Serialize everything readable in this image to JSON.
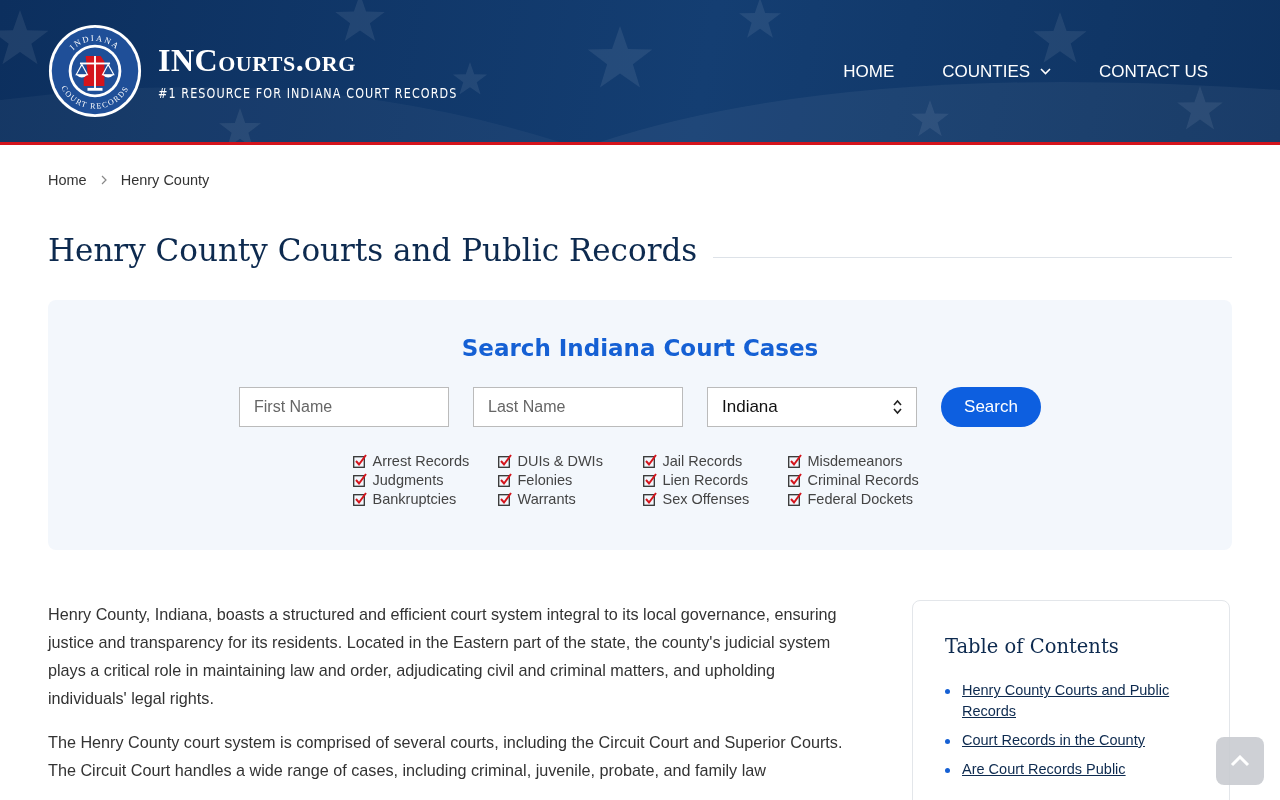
{
  "header": {
    "seal_top": "INDIANA",
    "seal_bottom": "COURT RECORDS",
    "site_name": "INCourts.org",
    "tagline": "#1 RESOURCE FOR INDIANA COURT RECORDS",
    "nav": [
      {
        "label": "HOME",
        "dropdown": false
      },
      {
        "label": "COUNTIES",
        "dropdown": true
      },
      {
        "label": "CONTACT US",
        "dropdown": false
      }
    ]
  },
  "breadcrumb": [
    "Home",
    "Henry County"
  ],
  "title": "Henry County Courts and Public Records",
  "search": {
    "heading": "Search Indiana Court Cases",
    "first_name": {
      "placeholder": "First Name"
    },
    "last_name": {
      "placeholder": "Last Name"
    },
    "state": "Indiana",
    "button": "Search",
    "record_types": [
      {
        "label": "Arrest Records",
        "checked": true
      },
      {
        "label": "DUIs & DWIs",
        "checked": true
      },
      {
        "label": "Jail Records",
        "checked": true
      },
      {
        "label": "Misdemeanors",
        "checked": true
      },
      {
        "label": "Judgments",
        "checked": true
      },
      {
        "label": "Felonies",
        "checked": true
      },
      {
        "label": "Lien Records",
        "checked": true
      },
      {
        "label": "Criminal Records",
        "checked": true
      },
      {
        "label": "Bankruptcies",
        "checked": true
      },
      {
        "label": "Warrants",
        "checked": true
      },
      {
        "label": "Sex Offenses",
        "checked": true
      },
      {
        "label": "Federal Dockets",
        "checked": true
      }
    ]
  },
  "paragraphs": [
    "Henry County, Indiana, boasts a structured and efficient court system integral to its local governance, ensuring justice and transparency for its residents. Located in the Eastern part of the state, the county's judicial system plays a critical role in maintaining law and order, adjudicating civil and criminal matters, and upholding individuals' legal rights.",
    "The Henry County court system is comprised of several courts, including the Circuit Court and Superior Courts. The Circuit Court handles a wide range of cases, including criminal, juvenile, probate, and family law"
  ],
  "toc": {
    "title": "Table of Contents",
    "items": [
      "Henry County Courts and Public Records",
      "Court Records in the County",
      "Are Court Records Public"
    ]
  }
}
